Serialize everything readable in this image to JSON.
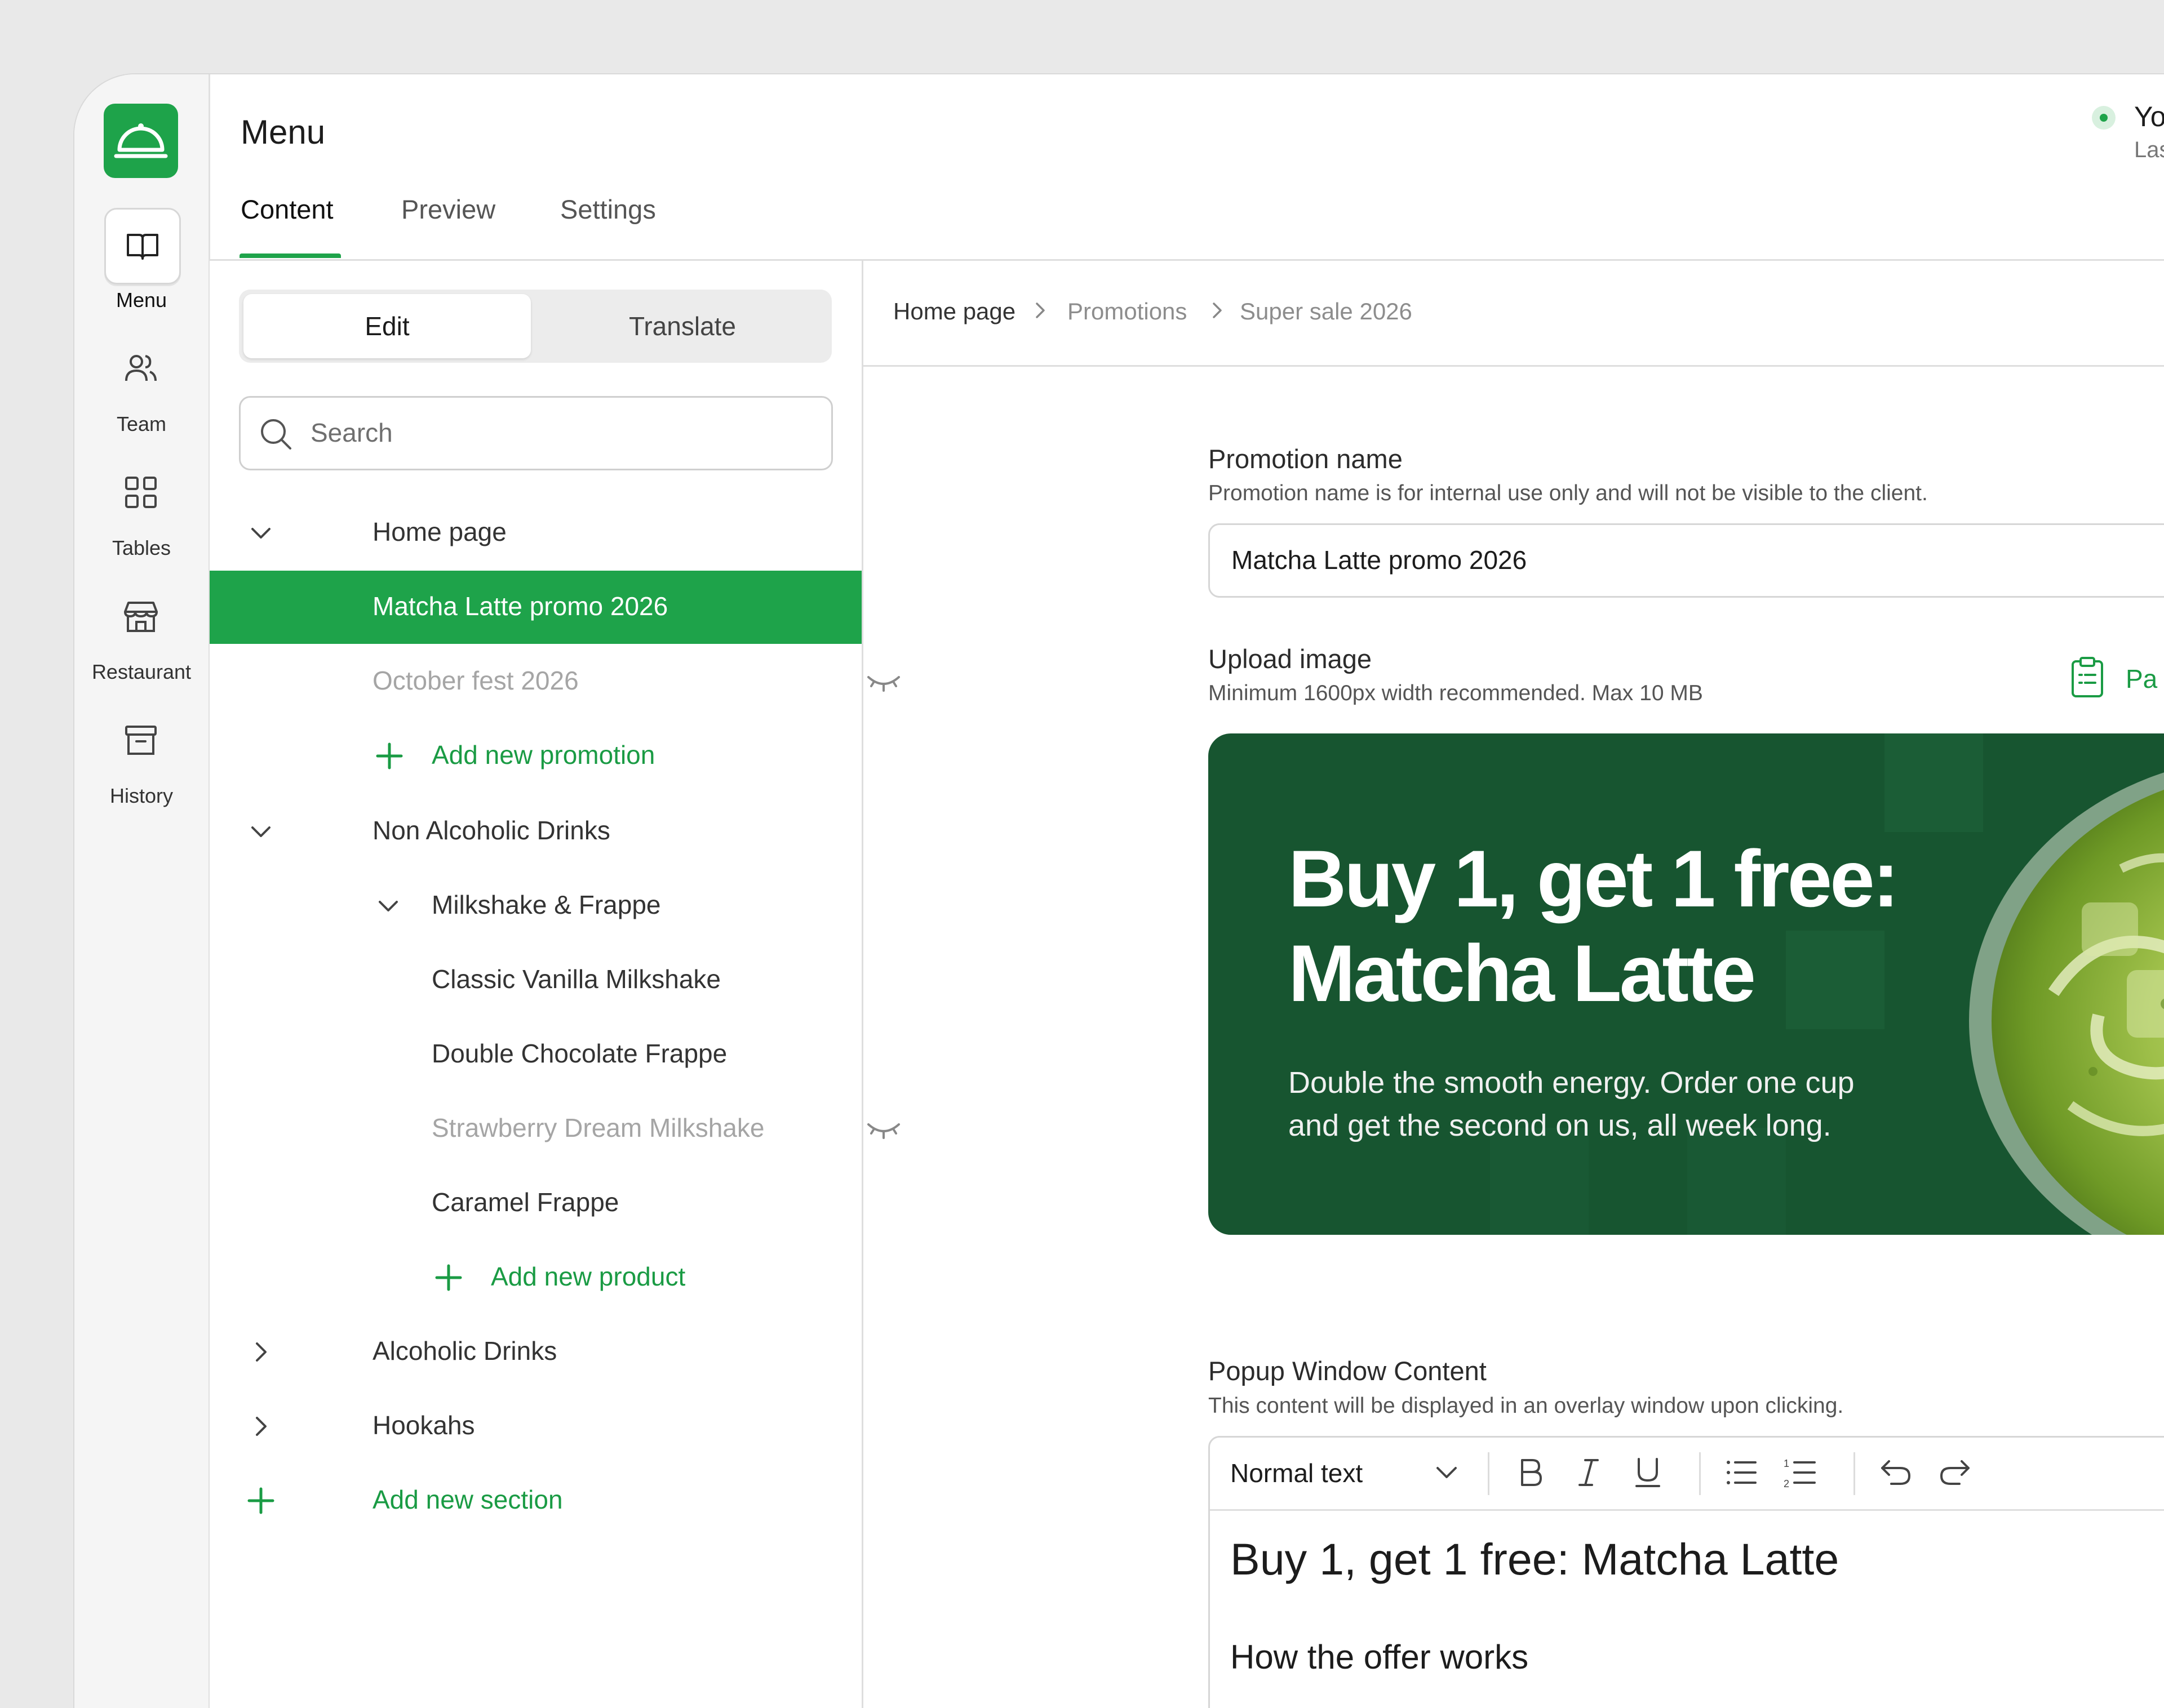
{
  "colors": {
    "accent": "#1ea34a",
    "banner_bg": "#175530",
    "muted_text": "#a5a5a5"
  },
  "rail": {
    "items": [
      {
        "label": "Menu",
        "icon": "book-open-icon"
      },
      {
        "label": "Team",
        "icon": "users-icon"
      },
      {
        "label": "Tables",
        "icon": "grid-icon"
      },
      {
        "label": "Restaurant",
        "icon": "store-icon"
      },
      {
        "label": "History",
        "icon": "archive-icon"
      }
    ]
  },
  "header": {
    "title": "Menu",
    "tabs": [
      "Content",
      "Preview",
      "Settings"
    ],
    "status_title": "Yo",
    "status_sub": "Las"
  },
  "sidebar": {
    "mode_tabs": [
      "Edit",
      "Translate"
    ],
    "search_placeholder": "Search",
    "tree": [
      {
        "label": "Home page",
        "kind": "section-expanded"
      },
      {
        "label": "Matcha Latte promo 2026",
        "kind": "selected"
      },
      {
        "label": "October fest 2026",
        "kind": "hidden"
      },
      {
        "label": "Add new promotion",
        "kind": "add"
      },
      {
        "label": "Non Alcoholic Drinks",
        "kind": "section-expanded"
      },
      {
        "label": "Milkshake & Frappe",
        "kind": "subsection-expanded"
      },
      {
        "label": "Classic Vanilla Milkshake",
        "kind": "item"
      },
      {
        "label": "Double Chocolate Frappe",
        "kind": "item"
      },
      {
        "label": "Strawberry Dream Milkshake",
        "kind": "hidden"
      },
      {
        "label": "Caramel Frappe",
        "kind": "item"
      },
      {
        "label": "Add new product",
        "kind": "add"
      },
      {
        "label": "Alcoholic Drinks",
        "kind": "section-collapsed"
      },
      {
        "label": "Hookahs",
        "kind": "section-collapsed"
      },
      {
        "label": "Add new section",
        "kind": "add"
      }
    ]
  },
  "breadcrumb": [
    "Home page",
    "Promotions",
    "Super sale 2026"
  ],
  "form": {
    "promotion_name": {
      "title": "Promotion name",
      "help": "Promotion name is for internal use only and will not be visible to the client.",
      "value": "Matcha Latte promo 2026"
    },
    "upload_image": {
      "title": "Upload image",
      "help": "Minimum 1600px width recommended. Max 10 MB",
      "paste_label": "Pa"
    },
    "banner": {
      "headline_line1": "Buy 1, get 1 free:",
      "headline_line2": "Matcha Latte",
      "body_line1": "Double the smooth energy. Order one cup",
      "body_line2": "and get the second on us, all week long."
    },
    "popup": {
      "title": "Popup Window Content",
      "help": "This content will be displayed in an overlay window upon clicking.",
      "text_style": "Normal text",
      "heading": "Buy 1, get 1 free: Matcha Latte",
      "subheading": "How the offer works"
    }
  }
}
